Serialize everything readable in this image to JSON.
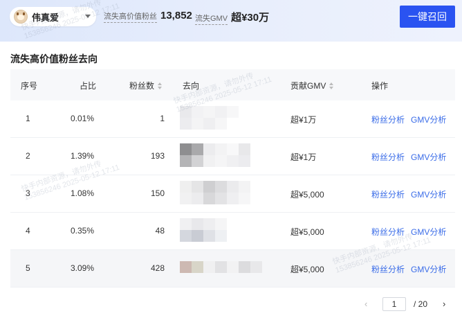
{
  "header": {
    "account_name": "伟真爱",
    "metrics": [
      {
        "label": "流失高价值粉丝",
        "value": "13,852"
      },
      {
        "label": "流失GMV",
        "value": "超¥30万"
      }
    ],
    "recall_button": "一键召回"
  },
  "section_title": "流失高价值粉丝去向",
  "table": {
    "columns": [
      "序号",
      "占比",
      "粉丝数",
      "去向",
      "贡献GMV",
      "操作"
    ],
    "rows": [
      {
        "index": "1",
        "ratio": "0.01%",
        "fans": "1",
        "gmv": "超¥1万",
        "action1": "粉丝分析",
        "action2": "GMV分析"
      },
      {
        "index": "2",
        "ratio": "1.39%",
        "fans": "193",
        "gmv": "超¥1万",
        "action1": "粉丝分析",
        "action2": "GMV分析"
      },
      {
        "index": "3",
        "ratio": "1.08%",
        "fans": "150",
        "gmv": "超¥5,000",
        "action1": "粉丝分析",
        "action2": "GMV分析"
      },
      {
        "index": "4",
        "ratio": "0.35%",
        "fans": "48",
        "gmv": "超¥5,000",
        "action1": "粉丝分析",
        "action2": "GMV分析"
      },
      {
        "index": "5",
        "ratio": "3.09%",
        "fans": "428",
        "gmv": "超¥5,000",
        "action1": "粉丝分析",
        "action2": "GMV分析"
      }
    ]
  },
  "pagination": {
    "current": "1",
    "total": "/ 20"
  },
  "watermark": {
    "line1": "快手内部资源，请勿外传",
    "line2": "153856246 2025-05-12 17:11"
  },
  "icons": {
    "prev": "chevron-left-icon",
    "next": "chevron-right-icon",
    "caret": "caret-down-icon"
  },
  "colors": {
    "accent": "#2a53f1",
    "link": "#3a6ce8"
  }
}
